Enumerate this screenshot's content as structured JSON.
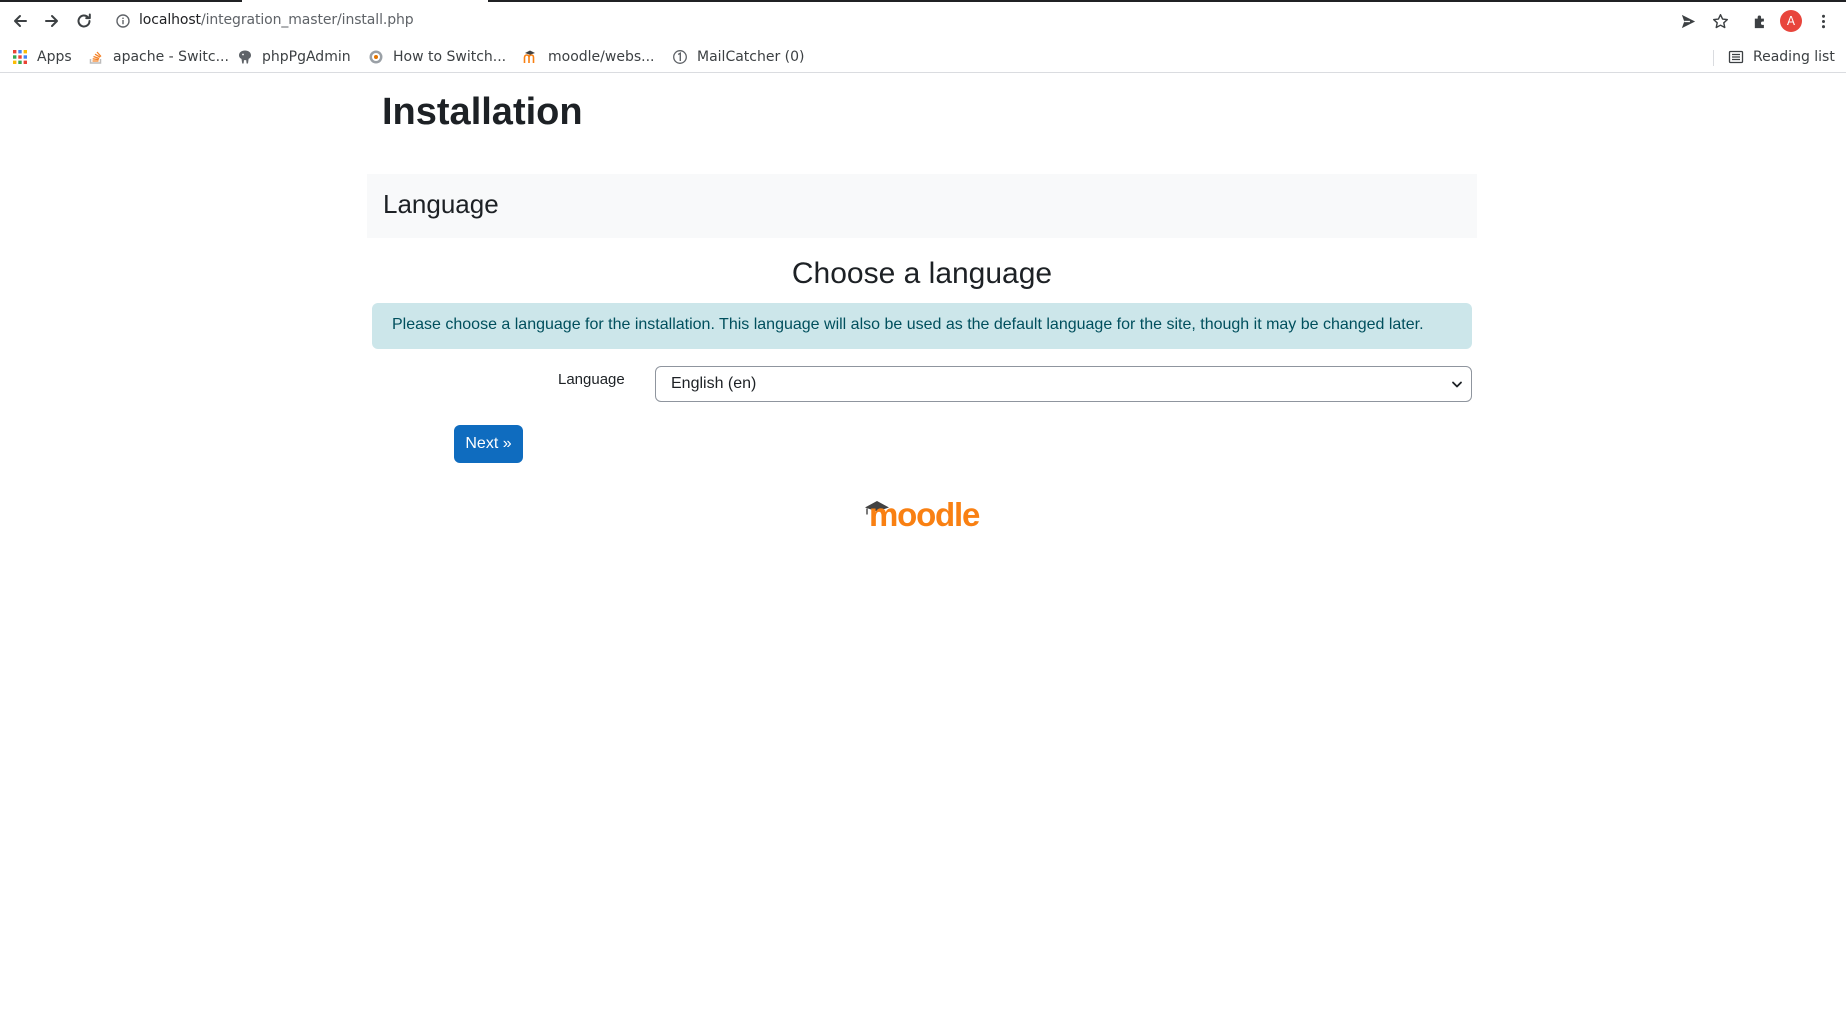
{
  "browser": {
    "url_host": "localhost",
    "url_path": "/integration_master/install.php",
    "profile_initial": "A",
    "accent_color": "#e8453c"
  },
  "bookmarks": {
    "items": [
      {
        "label": "Apps",
        "icon": "apps-grid-icon"
      },
      {
        "label": "apache - Switc...",
        "icon": "stackoverflow-icon"
      },
      {
        "label": "phpPgAdmin",
        "icon": "elephant-icon"
      },
      {
        "label": "How to Switch...",
        "icon": "site-favicon-icon"
      },
      {
        "label": "moodle/webs...",
        "icon": "moodle-favicon-icon"
      },
      {
        "label": "MailCatcher (0)",
        "icon": "mailcatcher-icon"
      }
    ],
    "reading_list": "Reading list"
  },
  "page": {
    "title": "Installation",
    "section_title": "Language",
    "heading": "Choose a language",
    "info_text": "Please choose a language for the installation. This language will also be used as the default language for the site, though it may be changed later.",
    "language_label": "Language",
    "language_selected": "English (en)",
    "next_button": "Next »",
    "logo_text": "moodle"
  },
  "colors": {
    "primary_button": "#0f6cbf",
    "info_bg": "#cce6ea",
    "info_text": "#004f5d",
    "moodle_orange": "#f98012"
  }
}
